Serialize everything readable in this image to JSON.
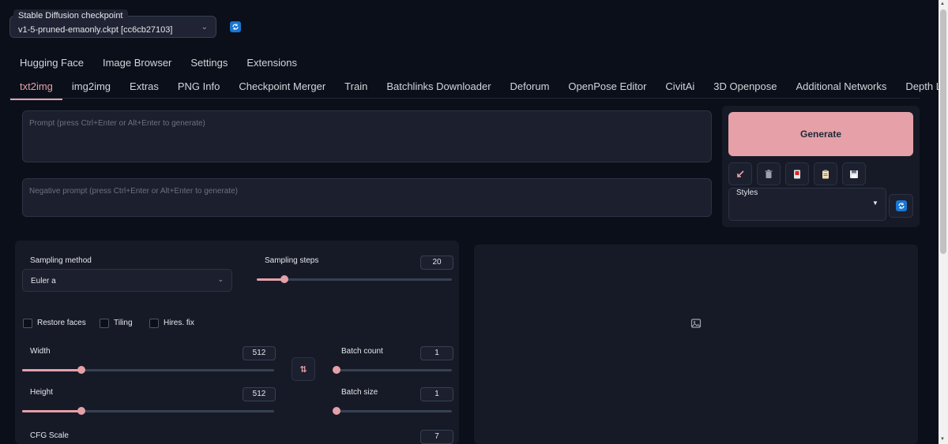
{
  "checkpoint": {
    "label": "Stable Diffusion checkpoint",
    "value": "v1-5-pruned-emaonly.ckpt [cc6cb27103]"
  },
  "top_tabs": [
    "Hugging Face",
    "Image Browser",
    "Settings",
    "Extensions"
  ],
  "main_tabs": [
    "txt2img",
    "img2img",
    "Extras",
    "PNG Info",
    "Checkpoint Merger",
    "Train",
    "Batchlinks Downloader",
    "Deforum",
    "OpenPose Editor",
    "CivitAi",
    "3D Openpose",
    "Additional Networks",
    "Depth Library"
  ],
  "active_tab": "txt2img",
  "prompt": {
    "placeholder": "Prompt (press Ctrl+Enter or Alt+Enter to generate)"
  },
  "negative_prompt": {
    "placeholder": "Negative prompt (press Ctrl+Enter or Alt+Enter to generate)"
  },
  "generate_label": "Generate",
  "tool_buttons": [
    "arrow-icon",
    "trash-icon",
    "red-card-icon",
    "clipboard-icon",
    "save-icon"
  ],
  "styles": {
    "label": "Styles",
    "value": ""
  },
  "sampling": {
    "method_label": "Sampling method",
    "method_value": "Euler a",
    "steps_label": "Sampling steps",
    "steps_value": "20",
    "steps_fraction": 0.14
  },
  "checkboxes": [
    "Restore faces",
    "Tiling",
    "Hires. fix"
  ],
  "width": {
    "label": "Width",
    "value": "512",
    "fraction": 0.235
  },
  "height": {
    "label": "Height",
    "value": "512",
    "fraction": 0.235
  },
  "batch_count": {
    "label": "Batch count",
    "value": "1",
    "fraction": 0.0
  },
  "batch_size": {
    "label": "Batch size",
    "value": "1",
    "fraction": 0.0
  },
  "cfg_scale": {
    "label": "CFG Scale",
    "value": "7"
  },
  "colors": {
    "accent": "#e5a0a8",
    "background": "#0b0f19",
    "panel": "#161a27",
    "refresh": "#1976d2"
  }
}
